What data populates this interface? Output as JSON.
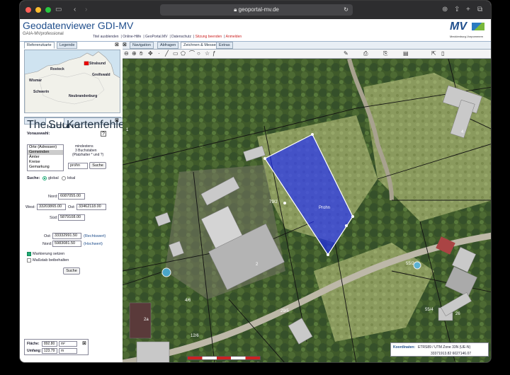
{
  "browser": {
    "url": "geoportal-mv.de"
  },
  "app": {
    "title": "Geodatenviewer GDI-MV",
    "subtitle": "GAIA-MVprofessional",
    "links": [
      "Titel ausblenden",
      "Online-Hilfe",
      "GeoPortal.MV",
      "Datenschutz",
      "Sitzung beenden",
      "Anmelden"
    ],
    "logo_text": "MV",
    "logo_sub": "Mecklenburg-Vorpommern"
  },
  "refpanel": {
    "tabs": [
      "Referenzkarte",
      "Legende"
    ],
    "cities": [
      "Stralsund",
      "Rostock",
      "Greifswald",
      "Wismar",
      "Schwerin",
      "Neubrandenburg"
    ]
  },
  "searchpanel": {
    "tabs": [
      "Themen",
      "Suche",
      "Kartenfehler?"
    ],
    "vorauswahl_label": "Vorauswahl:",
    "hint": [
      "mindestens",
      "3 Buchstaben",
      "(Platzhalter * und ?)"
    ],
    "list_options": [
      "Orte (Adressen)",
      "Gemeinden",
      "Ämter",
      "Kreise",
      "Gemarkung"
    ],
    "selected_option": "Gemeinden",
    "search_value": "prohn",
    "search_button": "Suche",
    "suche_label": "Suche:",
    "radio_global": "global",
    "radio_lokal": "lokal",
    "nord_label": "Nord:",
    "nord_value": "6087055.00",
    "west_label": "West:",
    "west_value": "33203865.00",
    "ost_label": "Ost:",
    "ost_value": "33462118.00",
    "sued_label": "Süd:",
    "sued_value": "5879108.00",
    "ost2_label": "Ost:",
    "ost2_value": "33332991.50",
    "ost2_note": "(Rechtswert)",
    "nord2_label": "Nord:",
    "nord2_value": "5983081.50",
    "nord2_note": "(Hochwert)",
    "check1": "Markierung setzen",
    "check2": "Maßstab beibehalten",
    "search_button2": "Suche"
  },
  "map": {
    "tabs": [
      "Navigation",
      "Abfragen",
      "Zeichnen & Messen",
      "Extras"
    ],
    "active_tab": "Zeichnen & Messen",
    "parcel_label": "Prohn",
    "labels": [
      "4",
      "79/2",
      "2",
      "2a",
      "55/2",
      "55/4",
      "4/6",
      "29/5",
      "12/6",
      "1",
      "26"
    ],
    "area_label": "Fläche:",
    "area_value": "892.80",
    "area_unit": "m²",
    "perimeter_label": "Umfang:",
    "perimeter_value": "123.79",
    "perimeter_unit": "m",
    "coord_label": "Koordinaten:",
    "coord_system": "ETRS89 / UTM Zone 33N (UE-N)",
    "coord_value": "33371913.82 6027146.07",
    "scale_ticks": [
      "0",
      "20",
      "40"
    ]
  },
  "colors": {
    "title": "#1f4e8c",
    "polygon": "#1f2bff",
    "imagery": "#5b6b42"
  }
}
